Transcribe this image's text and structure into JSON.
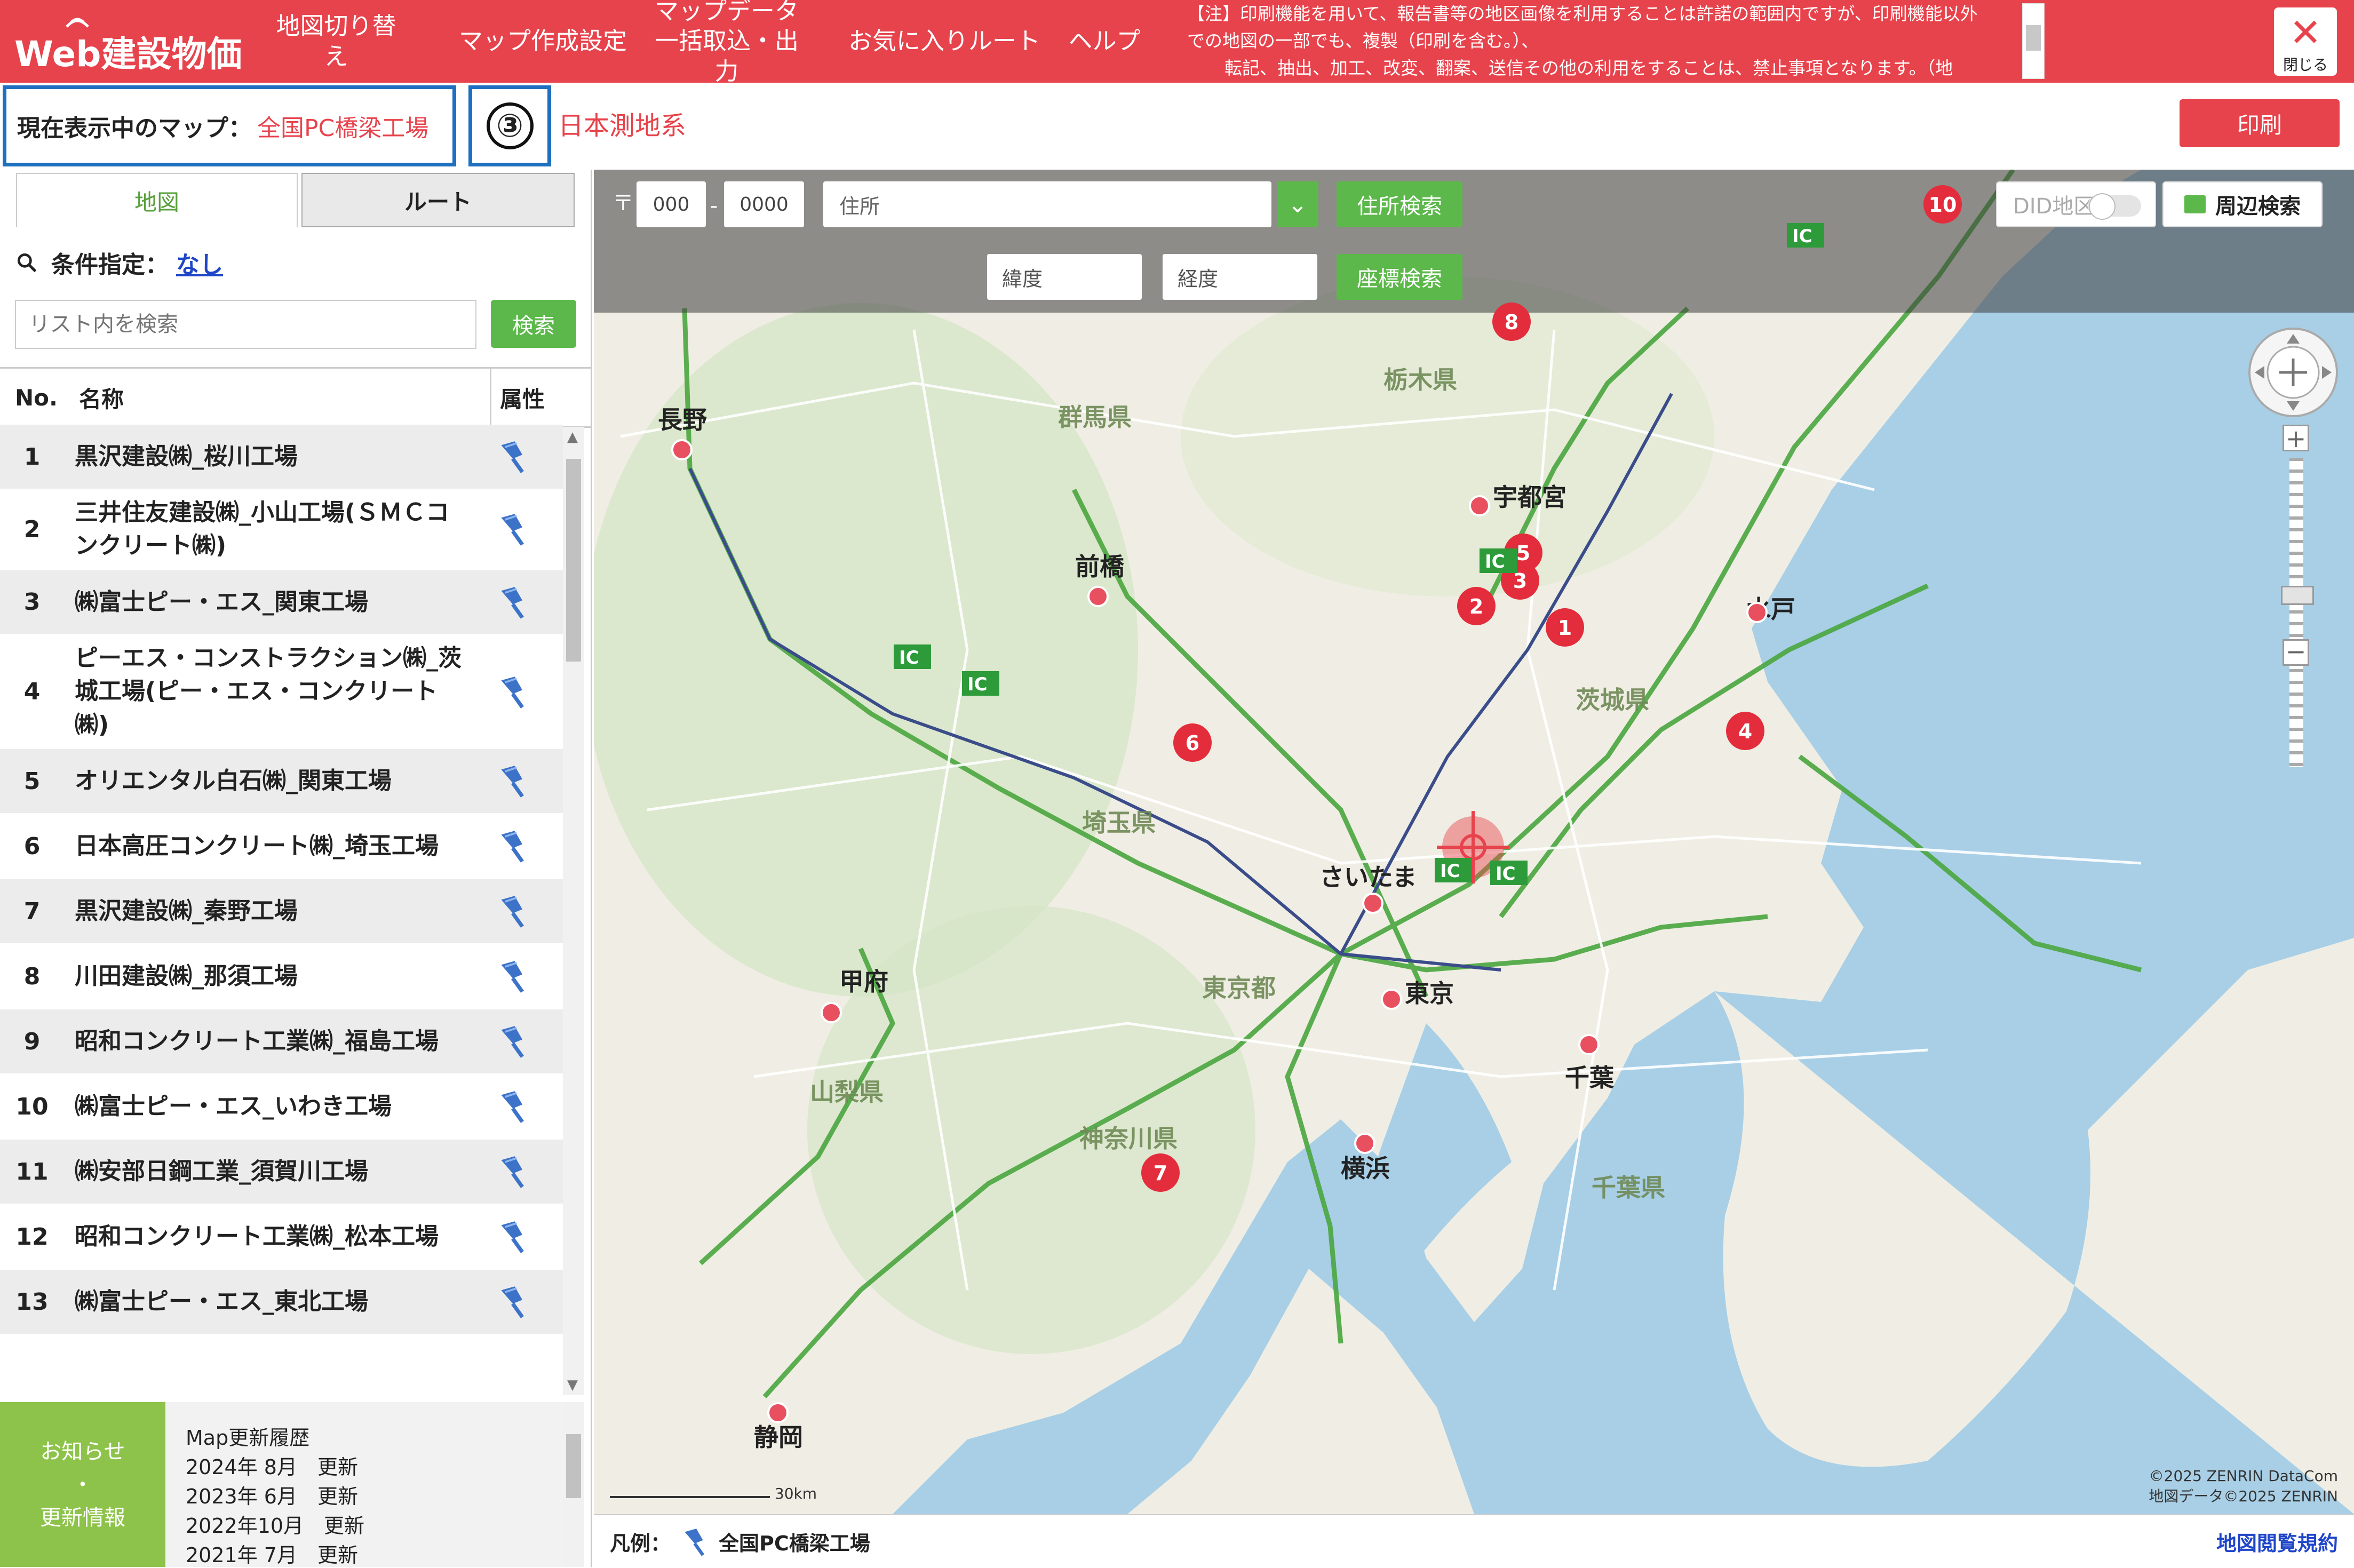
{
  "header": {
    "logo": "Web建設物価",
    "nav": [
      {
        "label": "地図切り替え"
      },
      {
        "label": "マップ作成設定"
      },
      {
        "label": "マップデータ\n一括取込・出力"
      },
      {
        "label": "お気に入りルート"
      },
      {
        "label": "ヘルプ"
      }
    ],
    "notice_line1": "【注】印刷機能を用いて、報告書等の地区画像を利用することは許諾の範囲内ですが、印刷機能以外",
    "notice_line2": "での地図の一部でも、複製（印刷を含む。）、",
    "notice_line3": "転記、抽出、加工、改変、翻案、送信その他の利用をすることは、禁止事項となります。（地",
    "close_label": "閉じる"
  },
  "infobar": {
    "current_map_label": "現在表示中のマップ：",
    "current_map_value": "全国PC橋梁工場",
    "callout": "③",
    "datum": "日本測地系",
    "print": "印刷"
  },
  "left": {
    "tab_map": "地図",
    "tab_route": "ルート",
    "cond_label": "条件指定：",
    "cond_value": "なし",
    "search_placeholder": "リスト内を検索",
    "search_button": "検索",
    "col_no": "No.",
    "col_name": "名称",
    "col_attr": "属性",
    "rows": [
      {
        "no": "1",
        "name": "黒沢建設㈱_桜川工場"
      },
      {
        "no": "2",
        "name": "三井住友建設㈱_小山工場(ＳＭＣコンクリート㈱)"
      },
      {
        "no": "3",
        "name": "㈱富士ピー・エス_関東工場"
      },
      {
        "no": "4",
        "name": "ピーエス・コンストラクション㈱_茨城工場(ピー・エス・コンクリート㈱)"
      },
      {
        "no": "5",
        "name": "オリエンタル白石㈱_関東工場"
      },
      {
        "no": "6",
        "name": "日本高圧コンクリート㈱_埼玉工場"
      },
      {
        "no": "7",
        "name": "黒沢建設㈱_秦野工場"
      },
      {
        "no": "8",
        "name": "川田建設㈱_那須工場"
      },
      {
        "no": "9",
        "name": "昭和コンクリート工業㈱_福島工場"
      },
      {
        "no": "10",
        "name": "㈱富士ピー・エス_いわき工場"
      },
      {
        "no": "11",
        "name": "㈱安部日鋼工業_須賀川工場"
      },
      {
        "no": "12",
        "name": "昭和コンクリート工業㈱_松本工場"
      },
      {
        "no": "13",
        "name": "㈱富士ピー・エス_東北工場"
      }
    ],
    "news_title": "お知らせ\n・\n更新情報",
    "news_heading": "Map更新履歴",
    "news_items": [
      "2024年 8月　更新",
      "2023年 6月　更新",
      "2022年10月　更新",
      "2021年 7月　更新"
    ]
  },
  "map": {
    "zip_mark": "〒",
    "zip1": "000",
    "zip2": "0000",
    "address_placeholder": "住所",
    "address_search": "住所検索",
    "lat_placeholder": "緯度",
    "lng_placeholder": "経度",
    "coord_search": "座標検索",
    "did": "DID地区",
    "nearby": "周辺検索",
    "copyright1": "©2025 ZENRIN DataCom",
    "copyright2": "地図データ©2025 ZENRIN",
    "scale": "30km",
    "markers": [
      "1",
      "2",
      "3",
      "4",
      "5",
      "6",
      "7",
      "8",
      "10"
    ],
    "places": {
      "nagano": "長野",
      "maebashi": "前橋",
      "utsunomiya": "宇都宮",
      "mito": "水戸",
      "saitama": "さいたま",
      "tokyo": "東京",
      "chiba": "千葉",
      "yokohama": "横浜",
      "kofu": "甲府",
      "shizuoka": "静岡",
      "gunma": "群馬県",
      "tochigi": "栃木県",
      "ibaraki": "茨城県",
      "saitama_pref": "埼玉県",
      "tokyo_to": "東京都",
      "kanagawa": "神奈川県",
      "yamanashi": "山梨県",
      "chiba_pref": "千葉県"
    }
  },
  "legend": {
    "label": "凡例：",
    "item": "全国PC橋梁工場",
    "terms": "地図閲覧規約"
  },
  "colors": {
    "brand": "#e7434c",
    "accent_green": "#5cb84a",
    "callout_blue": "#1f6fc0"
  }
}
